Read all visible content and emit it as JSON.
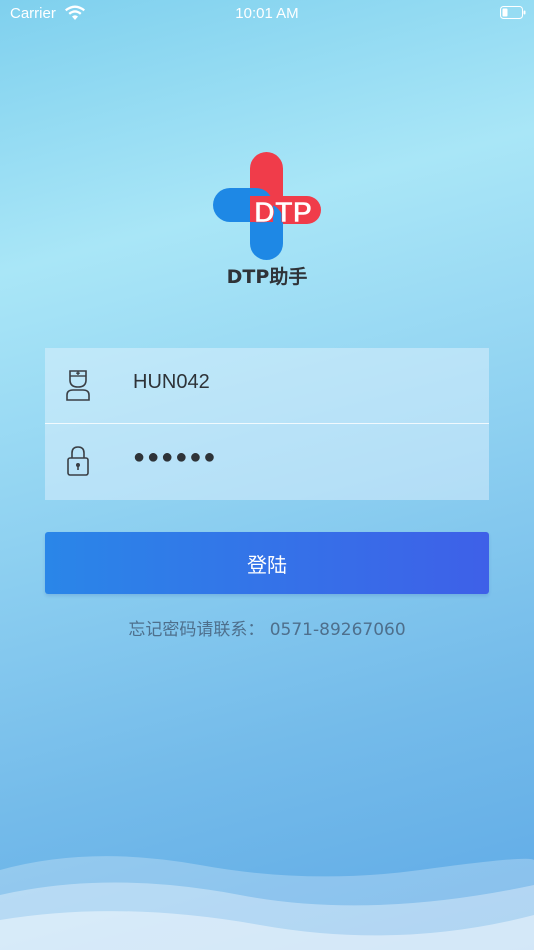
{
  "status_bar": {
    "carrier": "Carrier",
    "time": "10:01 AM",
    "wifi_icon": "wifi-icon",
    "battery_icon": "battery-icon"
  },
  "logo": {
    "text": "DTP",
    "colors": {
      "red": "#f03c4a",
      "blue": "#1e88e5",
      "text": "#ffffff"
    }
  },
  "app_name": "DTP助手",
  "form": {
    "username": {
      "icon": "doctor-user-icon",
      "value": "HUN042"
    },
    "password": {
      "icon": "lock-icon",
      "value": "●●●●●●"
    }
  },
  "login_button": {
    "label": "登陆"
  },
  "forgot_text": "忘记密码请联系：  0571-89267060"
}
